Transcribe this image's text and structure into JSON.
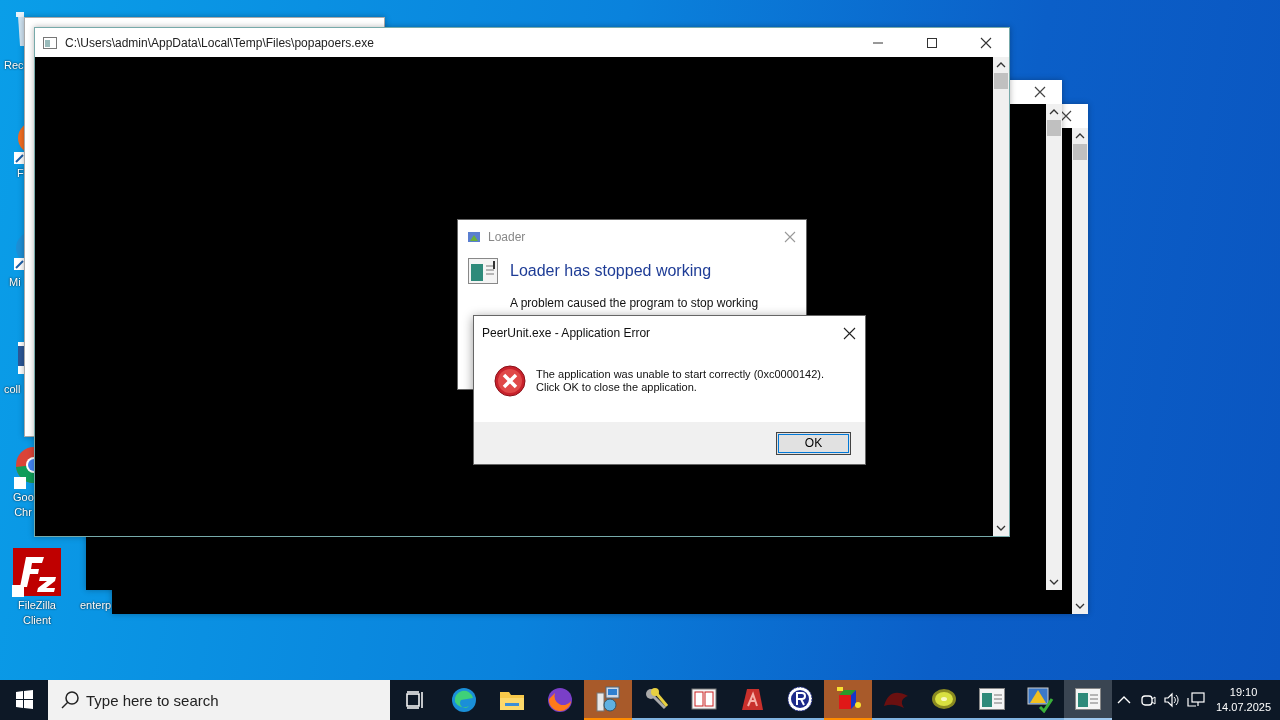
{
  "desktop": {
    "icons": [
      {
        "kind": "recycle",
        "label": "Rec"
      },
      {
        "kind": "firefox",
        "label": "F"
      },
      {
        "kind": "edge",
        "label": "Mi"
      },
      {
        "kind": "word",
        "label": "coll"
      },
      {
        "kind": "chrome",
        "label": "Goo Chr"
      },
      {
        "kind": "filezilla",
        "label": "FileZilla Client"
      },
      {
        "kind": "none",
        "label": "enterp"
      }
    ]
  },
  "console_window": {
    "title": "C:\\Users\\admin\\AppData\\Local\\Temp\\Files\\popapoers.exe"
  },
  "loader_dialog": {
    "title": "Loader",
    "heading": "Loader has stopped working",
    "message": "A problem caused the program to stop working"
  },
  "error_dialog": {
    "title": "PeerUnit.exe - Application Error",
    "message_lines": [
      "The application was unable to start correctly (0xc0000142).",
      "Click OK to close the application."
    ],
    "button": "OK"
  },
  "taskbar": {
    "search": {
      "placeholder": "Type here to search"
    },
    "apps": [
      {
        "kind": "edge",
        "running": false,
        "flashing": false,
        "selected": false
      },
      {
        "kind": "folder",
        "running": false,
        "flashing": false,
        "selected": false
      },
      {
        "kind": "firefox",
        "running": false,
        "flashing": false,
        "selected": false
      },
      {
        "kind": "setup",
        "running": true,
        "flashing": true,
        "selected": false
      },
      {
        "kind": "keys",
        "running": true,
        "flashing": false,
        "selected": false
      },
      {
        "kind": "calendar",
        "running": true,
        "flashing": false,
        "selected": false
      },
      {
        "kind": "acrobat",
        "running": true,
        "flashing": false,
        "selected": false
      },
      {
        "kind": "r",
        "running": true,
        "flashing": false,
        "selected": false
      },
      {
        "kind": "cube",
        "running": true,
        "flashing": true,
        "selected": false
      },
      {
        "kind": "dragon",
        "running": true,
        "flashing": false,
        "selected": false
      },
      {
        "kind": "kiwi",
        "running": true,
        "flashing": false,
        "selected": false
      },
      {
        "kind": "window",
        "running": true,
        "flashing": false,
        "selected": false
      },
      {
        "kind": "warning",
        "running": true,
        "flashing": false,
        "selected": false
      },
      {
        "kind": "window",
        "running": true,
        "flashing": false,
        "selected": true
      }
    ],
    "time": "19:10",
    "date": "14.07.2025"
  }
}
